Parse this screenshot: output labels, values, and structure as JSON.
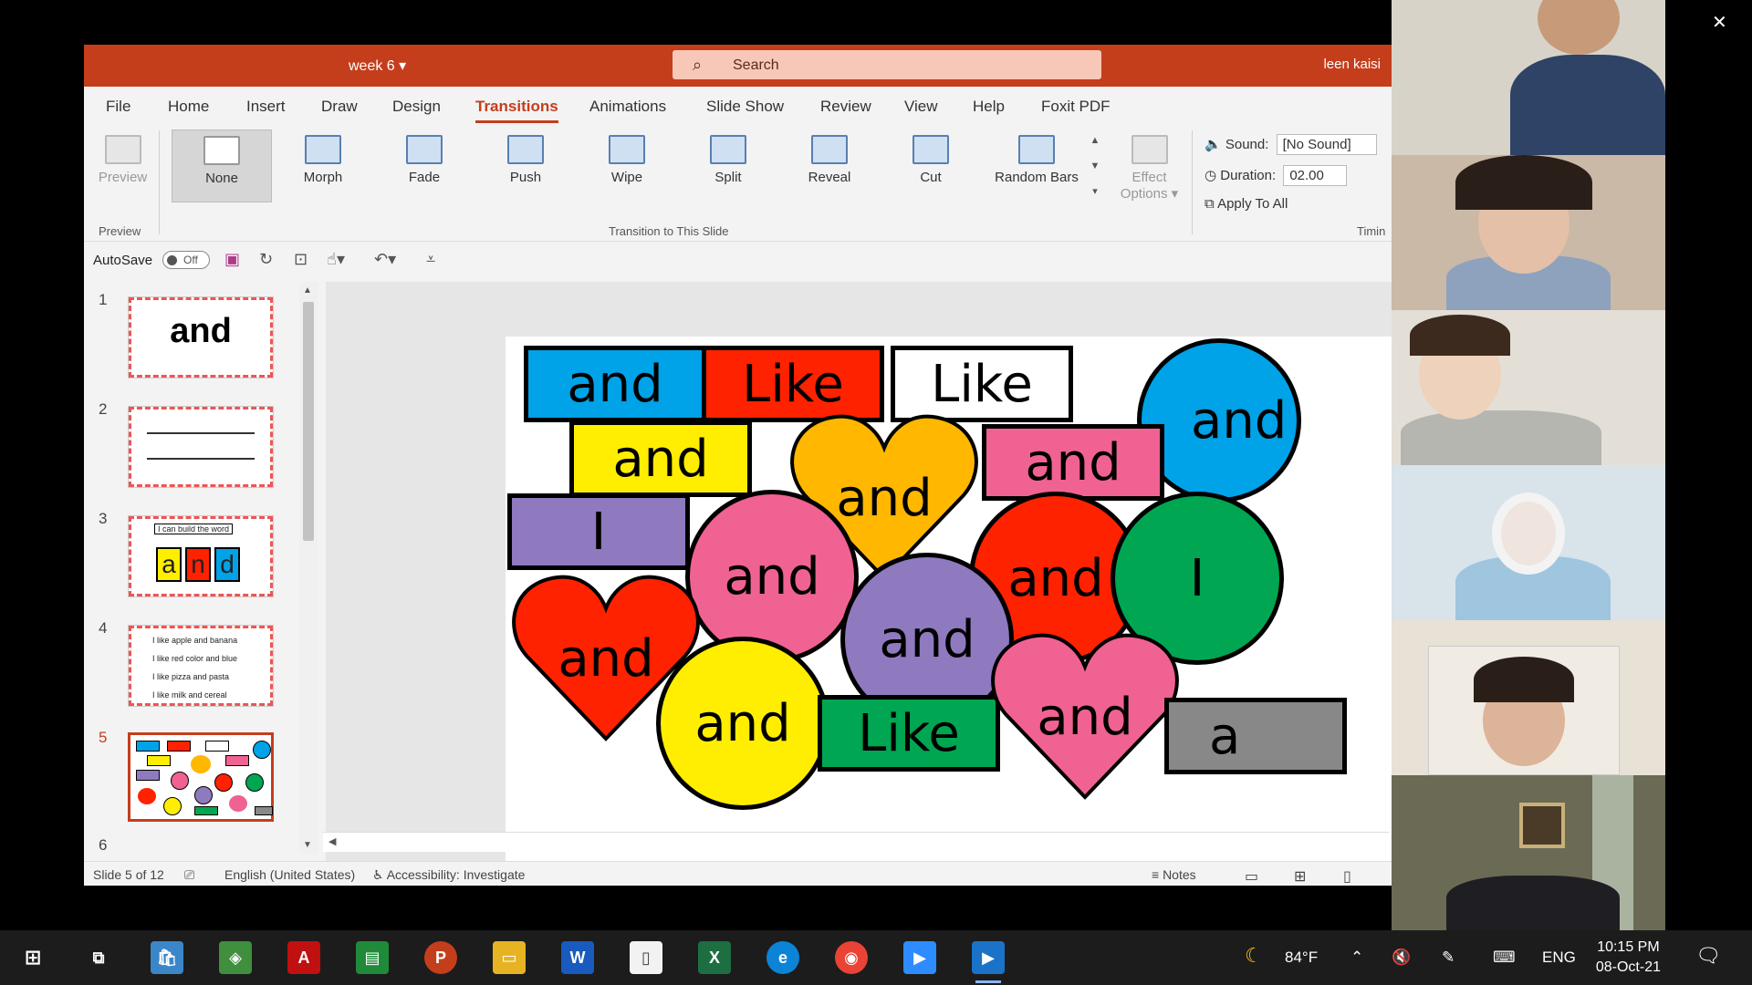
{
  "titlebar": {
    "doc_title": "week 6",
    "search_placeholder": "Search",
    "user": "leen kaisi"
  },
  "menu": [
    "File",
    "Home",
    "Insert",
    "Draw",
    "Design",
    "Transitions",
    "Animations",
    "Slide Show",
    "Review",
    "View",
    "Help",
    "Foxit PDF"
  ],
  "menu_active": "Transitions",
  "ribbon": {
    "preview": "Preview",
    "preview_group": "Preview",
    "transitions": [
      "None",
      "Morph",
      "Fade",
      "Push",
      "Wipe",
      "Split",
      "Reveal",
      "Cut",
      "Random Bars"
    ],
    "transitions_group": "Transition to This Slide",
    "effect_options_1": "Effect",
    "effect_options_2": "Options",
    "sound_label": "Sound:",
    "sound_value": "[No Sound]",
    "duration_label": "Duration:",
    "duration_value": "02.00",
    "apply_all": "Apply To All",
    "timing_group": "Timin"
  },
  "qat": {
    "autosave": "AutoSave",
    "toggle_state": "Off"
  },
  "thumbnails": [
    {
      "num": "1",
      "text": "and"
    },
    {
      "num": "2",
      "text": ""
    },
    {
      "num": "3",
      "text": "I can build the word",
      "letters": [
        "a",
        "n",
        "d"
      ]
    },
    {
      "num": "4",
      "lines": [
        "I like apple and banana",
        "I like red color and blue",
        "I like pizza and pasta",
        "I like milk and cereal"
      ]
    },
    {
      "num": "5",
      "text": ""
    },
    {
      "num": "6",
      "text": ""
    }
  ],
  "slide": {
    "w1": "and",
    "w2": "Like",
    "w3": "Like",
    "w4": "and",
    "w5": "and",
    "w6": "and",
    "w7": "and",
    "w8": "I",
    "w9": "and",
    "w10": "and",
    "w11": "I",
    "w12": "and",
    "w13": "and",
    "w14": "and",
    "w15": "Like",
    "w16": "and",
    "w17": "a"
  },
  "status": {
    "slide": "Slide 5 of 12",
    "language": "English (United States)",
    "accessibility": "Accessibility: Investigate",
    "notes": "Notes"
  },
  "tray": {
    "temp": "84°F",
    "lang": "ENG",
    "time": "10:15 PM",
    "date": "08-Oct-21"
  },
  "colors": {
    "accent": "#c43e1c",
    "blue": "#00a2e8",
    "red": "#ff2200",
    "yellow": "#ffee00",
    "pink": "#f06292",
    "purple": "#8f79bf",
    "green": "#00a651",
    "orange": "#ffb700"
  }
}
